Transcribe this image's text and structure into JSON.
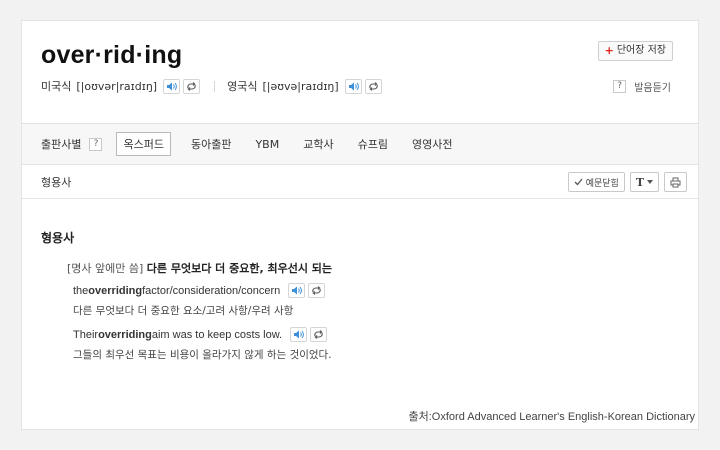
{
  "entry": {
    "word": "over·rid·ing",
    "save_label": "단어장 저장"
  },
  "pronunciation": {
    "us_label": "미국식",
    "us_ipa": "[|oʊvər|raɪdɪŋ]",
    "uk_label": "영국식",
    "uk_ipa": "[|əʊvə|raɪdɪŋ]",
    "help_label": "발음듣기"
  },
  "tabs": {
    "publisher_label": "출판사별",
    "items": [
      "옥스퍼드",
      "동아출판",
      "YBM",
      "교학사",
      "슈프림",
      "영영사전"
    ],
    "active": "옥스퍼드"
  },
  "pos_bar": {
    "label": "형용사",
    "example_toggle": "예문닫힘",
    "font_button": "T"
  },
  "content": {
    "pos_heading": "형용사",
    "sense": {
      "grammar": "[명사 앞에만 씀]",
      "definition": "다른 무엇보다 더 중요한, 최우선시 되는"
    },
    "examples": [
      {
        "en_pre": "the ",
        "en_bold": "overriding",
        "en_post": " factor/consideration/concern",
        "ko": "다른 무엇보다 더 중요한 요소/고려 사항/우려 사항"
      },
      {
        "en_pre": "Their ",
        "en_bold": "overriding",
        "en_post": " aim was to keep costs low.",
        "ko": "그들의 최우선 목표는 비용이 올라가지 않게 하는 것이었다."
      }
    ],
    "source": "출처:Oxford Advanced Learner's English-Korean Dictionary"
  },
  "colors": {
    "speaker_blue": "#3f8fd8",
    "plus_red": "#e0241d"
  }
}
